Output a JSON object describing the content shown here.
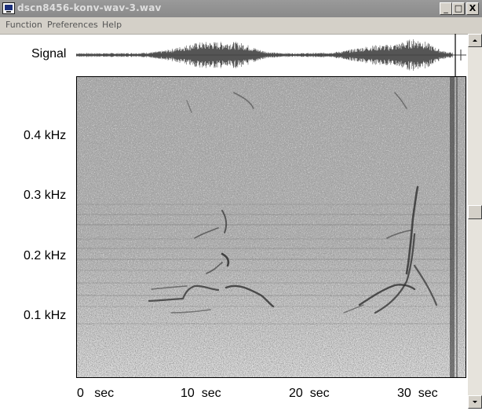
{
  "window": {
    "title": "dscn8456-konv-wav-3.wav",
    "controls": {
      "minimize": "_",
      "maximize": "□",
      "close": "X"
    }
  },
  "menu": [
    {
      "label": "Function"
    },
    {
      "label": "Preferences"
    },
    {
      "label": "Help"
    }
  ],
  "signal_panel": {
    "label": "Signal"
  },
  "frequency_axis": {
    "labels": [
      "0.4 kHz",
      "0.3 kHz",
      "0.2 kHz",
      "0.1 kHz"
    ]
  },
  "time_axis": {
    "labels": [
      "0   sec",
      "10  sec",
      "20  sec",
      "30  sec"
    ]
  },
  "icons": {
    "scroll_up": "triangle-up-icon",
    "scroll_down": "triangle-down-icon",
    "app": "computer-icon"
  },
  "colors": {
    "titlebar": "#8f8f8f",
    "chrome": "#d4d0c8",
    "waveform": "#555555",
    "spectrogram_bg": "#bdbdbd"
  }
}
